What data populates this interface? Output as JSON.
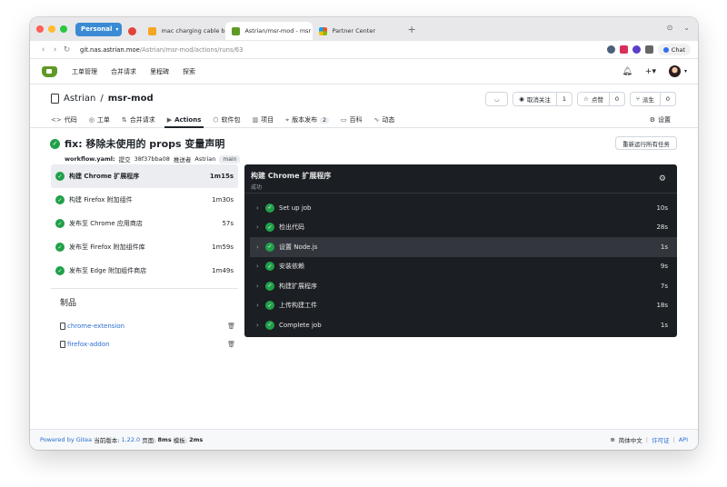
{
  "browser": {
    "profile": "Personal",
    "tabs": [
      {
        "title": "",
        "active": false
      },
      {
        "title": "mac charging cable bl",
        "active": false
      },
      {
        "title": "Astrian/msr-mod - msr",
        "active": true
      },
      {
        "title": "Partner Center",
        "active": false
      }
    ],
    "new_tab": "+",
    "url_host": "git.nas.astrian.moe",
    "url_path": "/Astrian/msr-mod/actions/runs/63",
    "chat_label": "Chat"
  },
  "navbar": {
    "items": [
      "工单管理",
      "合并请求",
      "里程碑",
      "探索"
    ]
  },
  "repo": {
    "owner": "Astrian",
    "name": "msr-mod",
    "separator": "/",
    "rss_icon": "rss-icon",
    "watch_label": "取消关注",
    "watch_count": "1",
    "star_label": "点赞",
    "star_count": "0",
    "fork_label": "派生",
    "fork_count": "0",
    "tabs": [
      {
        "icon": "code-icon",
        "label": "代码",
        "glyph": "<>"
      },
      {
        "icon": "issue-icon",
        "label": "工单",
        "glyph": "◎"
      },
      {
        "icon": "pull-request-icon",
        "label": "合并请求",
        "glyph": "⇅"
      },
      {
        "icon": "actions-icon",
        "label": "Actions",
        "glyph": "▶",
        "active": true
      },
      {
        "icon": "package-icon",
        "label": "软件包",
        "glyph": "⬡"
      },
      {
        "icon": "project-icon",
        "label": "项目",
        "glyph": "▥"
      },
      {
        "icon": "tag-icon",
        "label": "版本发布",
        "glyph": "⌖",
        "badge": "2"
      },
      {
        "icon": "wiki-icon",
        "label": "百科",
        "glyph": "▭"
      },
      {
        "icon": "activity-icon",
        "label": "动态",
        "glyph": "∿"
      }
    ],
    "settings_label": "设置"
  },
  "run": {
    "title": "fix: 移除未使用的 props 变量声明",
    "workflow": "workflow.yaml:",
    "commit_text": "提交",
    "commit_sha": "38f37bba08",
    "pusher_text": "推送者",
    "pusher": "Astrian",
    "branch": "main",
    "rerun_label": "重新运行所有任务"
  },
  "jobs": [
    {
      "name": "构建 Chrome 扩展程序",
      "duration": "1m15s",
      "active": true
    },
    {
      "name": "构建 Firefox 附加组件",
      "duration": "1m30s"
    },
    {
      "name": "发布至 Chrome 应用商店",
      "duration": "57s"
    },
    {
      "name": "发布至 Firefox 附加组件库",
      "duration": "1m59s"
    },
    {
      "name": "发布至 Edge 附加组件商店",
      "duration": "1m49s"
    }
  ],
  "artifacts": {
    "title": "制品",
    "items": [
      "chrome-extension",
      "firefox-addon"
    ]
  },
  "log": {
    "title": "构建 Chrome 扩展程序",
    "status": "成功",
    "steps": [
      {
        "name": "Set up job",
        "duration": "10s"
      },
      {
        "name": "检出代码",
        "duration": "28s"
      },
      {
        "name": "设置 Node.js",
        "duration": "1s",
        "active": true
      },
      {
        "name": "安装依赖",
        "duration": "9s"
      },
      {
        "name": "构建扩展程序",
        "duration": "7s"
      },
      {
        "name": "上传构建工件",
        "duration": "18s"
      },
      {
        "name": "Complete job",
        "duration": "1s"
      }
    ]
  },
  "footer": {
    "powered": "Powered by Gitea",
    "version_label": "当前版本:",
    "version": "1.22.0",
    "page_label": "页面:",
    "page_time": "8ms",
    "template_label": "模板:",
    "template_time": "2ms",
    "language": "简体中文",
    "license": "许可证",
    "api": "API"
  }
}
